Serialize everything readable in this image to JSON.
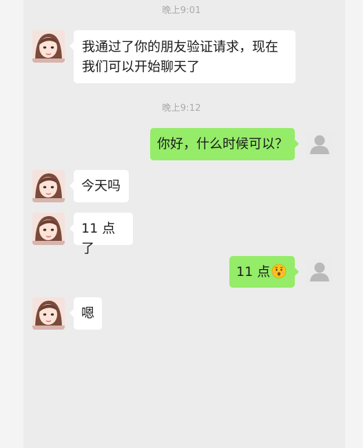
{
  "chat": {
    "timestamps": [
      "晚上9:01",
      "晚上9:12"
    ],
    "messages": [
      {
        "from": "contact",
        "lines": [
          "我通过了你的朋友验证请求，现在",
          "我们可以开始聊天了"
        ]
      },
      {
        "from": "self",
        "text": "你好，什么时候可以？"
      },
      {
        "from": "contact",
        "text": "今天吗"
      },
      {
        "from": "contact",
        "text": "11 点了"
      },
      {
        "from": "self",
        "text": "11 点",
        "emoji": "hushed-face-emoji"
      },
      {
        "from": "contact",
        "text": "嗯"
      }
    ]
  },
  "avatars": {
    "contact_icon": "girl-portrait-avatar",
    "self_icon": "default-person-avatar"
  },
  "colors": {
    "background": "#ececec",
    "incoming_bubble": "#ffffff",
    "outgoing_bubble": "#95ec69",
    "timestamp_text": "#a9a9a9",
    "message_text": "#1a1a1a"
  }
}
